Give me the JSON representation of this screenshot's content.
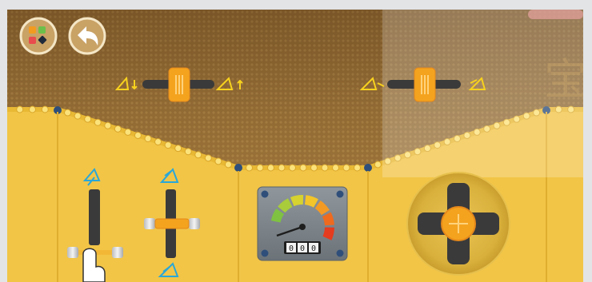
{
  "toolbar": {
    "menu_icon": "blocks-menu-icon",
    "back_icon": "back-arrow-icon"
  },
  "controls": {
    "left_slider": {
      "icons": [
        "boat-sail-down-icon",
        "boat-sail-up-icon"
      ],
      "level": 0.5
    },
    "right_slider": {
      "icons": [
        "boat-sail-left-icon",
        "boat-sail-right-icon"
      ],
      "level": 0.5
    },
    "vertical_lever": {
      "icon": "boat-up-icon",
      "level": 0.55
    },
    "joystick_lever": {
      "icons": [
        "boat-forward-icon",
        "boat-backward-icon"
      ]
    },
    "dpad": {
      "icon": "directional-pad-icon"
    }
  },
  "gauge": {
    "odometer_digits": [
      "0",
      "0",
      "0"
    ]
  },
  "background": {
    "watermark_char": "宝"
  },
  "colors": {
    "panel_yellow": "#f2c547",
    "panel_edge": "#e0ae2e",
    "mesh_brown": "#8a6430",
    "handle_orange": "#f4a31f",
    "accent_blue": "#2aa7d8",
    "track_dark": "#3a3a3a"
  }
}
